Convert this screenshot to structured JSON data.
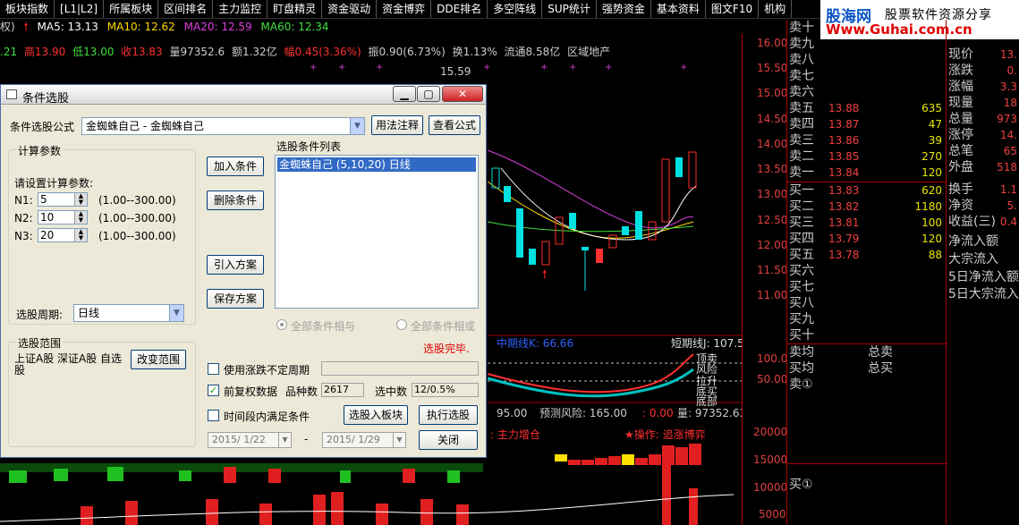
{
  "menu": [
    "板块指数",
    "[L1|L2]",
    "所属板块",
    "区间排名",
    "主力监控",
    "盯盘精灵",
    "资金驱动",
    "资金博弈",
    "DDE排名",
    "多空阵线",
    "SUP统计",
    "强势资金",
    "基本资料",
    "图文F10",
    "机构"
  ],
  "brand": {
    "name": "股海网",
    "tagline": "股票软件资源分享",
    "url": "Www.Guhai.com.cn"
  },
  "ma": {
    "ma5": "MA5: 13.13",
    "ma10": "MA10: 12.62",
    "ma20": "MA20: 12.59",
    "ma60": "MA60: 12.34",
    "prefix": "权)"
  },
  "quote": {
    "prev": ".21",
    "high": "高13.90",
    "low": "低13.00",
    "close": "收13.83",
    "vol": "量97352.6",
    "amount": "额1.32亿",
    "change": "幅0.45(3.36%)",
    "amplitude": "振0.90(6.73%)",
    "turnover": "换1.13%",
    "float": "流通8.58亿",
    "sector": "区域地产",
    "peak": "15.59"
  },
  "axis": [
    "16.00",
    "15.50",
    "15.00",
    "14.50",
    "14.00",
    "13.50",
    "13.00",
    "12.50",
    "12.00",
    "11.50",
    "11.00",
    "100.0",
    "50.00",
    "20000",
    "15000",
    "10000",
    "5000"
  ],
  "indicator": {
    "mid": "中期线K: 66.66",
    "short": "短期线J: 107.5",
    "tags": [
      "顶卖",
      "风险",
      "拉升",
      "底买",
      "底部"
    ]
  },
  "risk_line": {
    "a": "95.00",
    "risk": "预测风险: 165.00",
    "b": ": 0.00",
    "vol": "量: 97352.63",
    "inflow": ": 主力增仓",
    "op": "★操作: 追涨博弈"
  },
  "orderbook": {
    "sells": [
      {
        "label": "卖十",
        "price": "",
        "vol": ""
      },
      {
        "label": "卖九",
        "price": "",
        "vol": ""
      },
      {
        "label": "卖八",
        "price": "",
        "vol": ""
      },
      {
        "label": "卖七",
        "price": "",
        "vol": ""
      },
      {
        "label": "卖六",
        "price": "",
        "vol": ""
      },
      {
        "label": "卖五",
        "price": "13.88",
        "vol": "635"
      },
      {
        "label": "卖四",
        "price": "13.87",
        "vol": "47"
      },
      {
        "label": "卖三",
        "price": "13.86",
        "vol": "39"
      },
      {
        "label": "卖二",
        "price": "13.85",
        "vol": "270"
      },
      {
        "label": "卖一",
        "price": "13.84",
        "vol": "120"
      }
    ],
    "buys": [
      {
        "label": "买一",
        "price": "13.83",
        "vol": "620"
      },
      {
        "label": "买二",
        "price": "13.82",
        "vol": "1180"
      },
      {
        "label": "买三",
        "price": "13.81",
        "vol": "100"
      },
      {
        "label": "买四",
        "price": "13.79",
        "vol": "120"
      },
      {
        "label": "买五",
        "price": "13.78",
        "vol": "88"
      },
      {
        "label": "买六",
        "price": "",
        "vol": ""
      },
      {
        "label": "买七",
        "price": "",
        "vol": ""
      },
      {
        "label": "买八",
        "price": "",
        "vol": ""
      },
      {
        "label": "买九",
        "price": "",
        "vol": ""
      },
      {
        "label": "买十",
        "price": "",
        "vol": ""
      }
    ],
    "avg_sell": "卖均",
    "total_sell": "总卖",
    "avg_buy": "买均",
    "total_buy": "总买",
    "sell_one": "卖①",
    "buy_one": "买①"
  },
  "info": [
    {
      "label": "现价",
      "value": "13."
    },
    {
      "label": "涨跌",
      "value": "0."
    },
    {
      "label": "涨幅",
      "value": "3.3"
    },
    {
      "label": "现量",
      "value": "18"
    },
    {
      "label": "总量",
      "value": "973"
    },
    {
      "label": "涨停",
      "value": "14."
    },
    {
      "label": "总笔",
      "value": "65"
    },
    {
      "label": "外盘",
      "value": "518"
    },
    {
      "label": "换手",
      "value": "1.1"
    },
    {
      "label": "净资",
      "value": "5."
    },
    {
      "label": "收益(三)",
      "value": "0.4"
    },
    {
      "label": "净流入额",
      "value": ""
    },
    {
      "label": "大宗流入",
      "value": ""
    },
    {
      "label": "5日净流入额",
      "value": ""
    },
    {
      "label": "5日大宗流入",
      "value": ""
    }
  ],
  "dialog": {
    "title": "条件选股",
    "formula_label": "条件选股公式",
    "formula_value": "金蜘蛛自己 - 金蜘蛛自己",
    "usage_btn": "用法注释",
    "view_btn": "查看公式",
    "params_group": "计算参数",
    "params_hint": "请设置计算参数:",
    "params": [
      {
        "name": "N1:",
        "value": "5",
        "range": "(1.00--300.00)"
      },
      {
        "name": "N2:",
        "value": "10",
        "range": "(1.00--300.00)"
      },
      {
        "name": "N3:",
        "value": "20",
        "range": "(1.00--300.00)"
      }
    ],
    "period_label": "选股周期:",
    "period_value": "日线",
    "scope_group": "选股范围",
    "scope_text": "上证A股 深证A股 自选股",
    "scope_btn": "改变范围",
    "add_btn": "加入条件",
    "del_btn": "删除条件",
    "import_btn": "引入方案",
    "save_btn": "保存方案",
    "list_label": "选股条件列表",
    "list_item": "金蜘蛛自己 (5,10,20) 日线",
    "radio_and": "全部条件相与",
    "radio_or": "全部条件相或",
    "done": "选股完毕.",
    "chk_undefined": "使用涨跌不定周期",
    "chk_restore": "前复权数据",
    "count_label": "品种数",
    "count_value": "2617",
    "hit_label": "选中数",
    "hit_value": "12/0.5%",
    "chk_period": "时间段内满足条件",
    "to_block_btn": "选股入板块",
    "run_btn": "执行选股",
    "date_from": "2015/ 1/22",
    "dash": "-",
    "date_to": "2015/ 1/29",
    "close_btn": "关闭"
  }
}
